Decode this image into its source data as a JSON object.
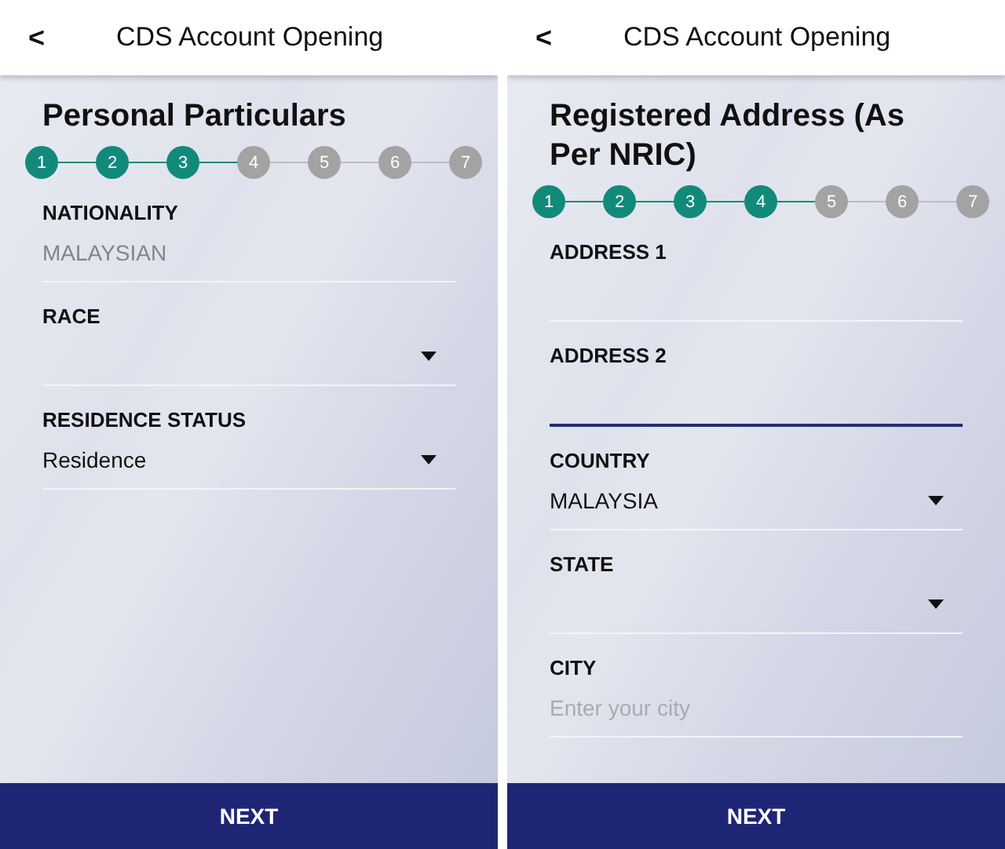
{
  "screens": [
    {
      "header": {
        "back": "<",
        "title": "CDS Account Opening"
      },
      "heading": "Personal Particulars",
      "steps": [
        {
          "label": "1",
          "done": true
        },
        {
          "label": "2",
          "done": true
        },
        {
          "label": "3",
          "done": true
        },
        {
          "label": "4",
          "done": false
        },
        {
          "label": "5",
          "done": false
        },
        {
          "label": "6",
          "done": false
        },
        {
          "label": "7",
          "done": false
        }
      ],
      "fields": [
        {
          "kind": "text",
          "label": "NATIONALITY",
          "value": "MALAYSIAN",
          "disabled": true,
          "focused": false
        },
        {
          "kind": "select",
          "label": "RACE",
          "focused": false
        },
        {
          "kind": "select",
          "label": "RESIDENCE STATUS",
          "value": "Residence",
          "focused": false
        }
      ],
      "button": "NEXT"
    },
    {
      "header": {
        "back": "<",
        "title": "CDS Account Opening"
      },
      "heading": "Registered Address (As Per NRIC)",
      "steps": [
        {
          "label": "1",
          "done": true
        },
        {
          "label": "2",
          "done": true
        },
        {
          "label": "3",
          "done": true
        },
        {
          "label": "4",
          "done": true
        },
        {
          "label": "5",
          "done": false
        },
        {
          "label": "6",
          "done": false
        },
        {
          "label": "7",
          "done": false
        }
      ],
      "fields": [
        {
          "kind": "text",
          "label": "ADDRESS 1",
          "focused": false
        },
        {
          "kind": "text",
          "label": "ADDRESS 2",
          "focused": true
        },
        {
          "kind": "select",
          "label": "COUNTRY",
          "value": "MALAYSIA",
          "focused": false
        },
        {
          "kind": "select",
          "label": "STATE",
          "focused": false
        },
        {
          "kind": "text",
          "label": "CITY",
          "placeholder": "Enter your city",
          "focused": false
        }
      ],
      "button": "NEXT"
    }
  ]
}
